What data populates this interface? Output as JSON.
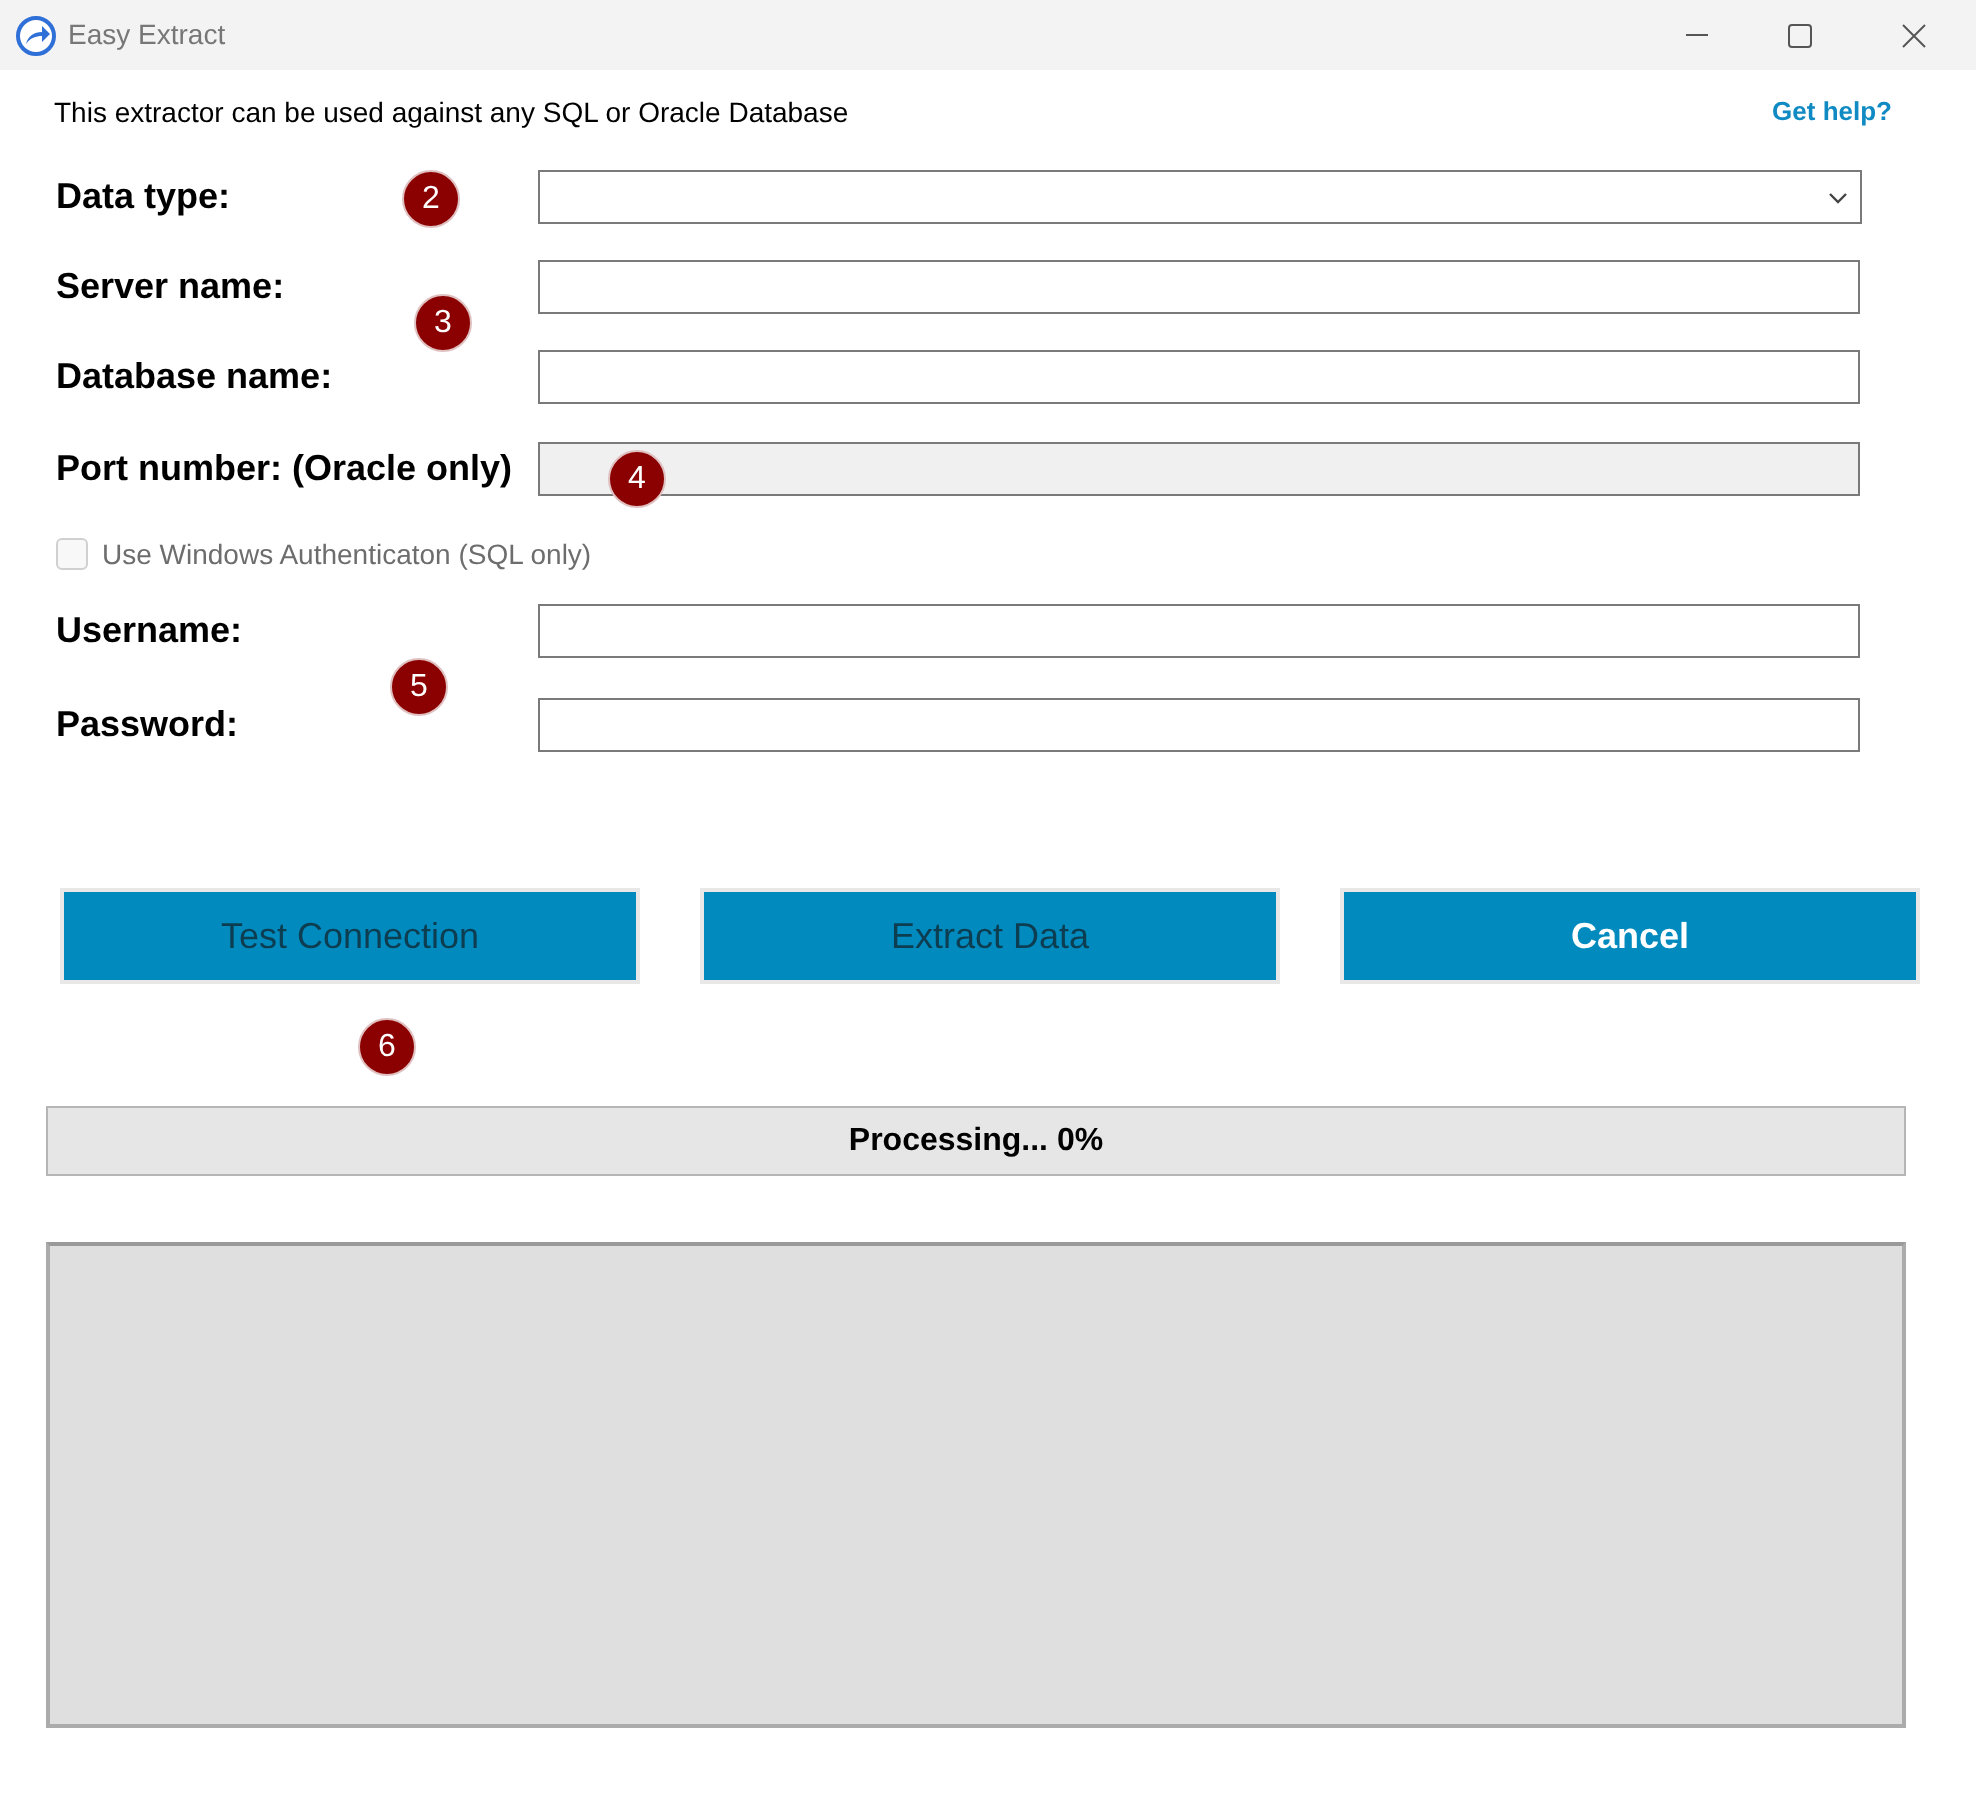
{
  "window": {
    "title": "Easy Extract"
  },
  "intro": "This extractor can be used against any SQL or Oracle Database",
  "help_link": "Get help?",
  "fields": [
    {
      "label": "Data type:",
      "kind": "select",
      "disabled": false
    },
    {
      "label": "Server name:",
      "kind": "text",
      "disabled": false
    },
    {
      "label": "Database name:",
      "kind": "text",
      "disabled": false
    },
    {
      "label": "Port number: (Oracle only)",
      "kind": "text",
      "disabled": true
    },
    {
      "label": "Use Windows Authenticaton (SQL only)",
      "kind": "checkbox",
      "checked": false,
      "disabled": true
    },
    {
      "label": "Username:",
      "kind": "text",
      "disabled": false
    },
    {
      "label": "Password:",
      "kind": "password",
      "disabled": false
    }
  ],
  "buttons": [
    {
      "label": "Test Connection",
      "disabled": true
    },
    {
      "label": "Extract Data",
      "disabled": true
    },
    {
      "label": "Cancel",
      "disabled": false
    }
  ],
  "progress": {
    "text": "Processing... 0%",
    "level": 0
  },
  "callouts": [
    {
      "number": "2"
    },
    {
      "number": "3"
    },
    {
      "number": "4"
    },
    {
      "number": "5"
    },
    {
      "number": "6"
    }
  ]
}
